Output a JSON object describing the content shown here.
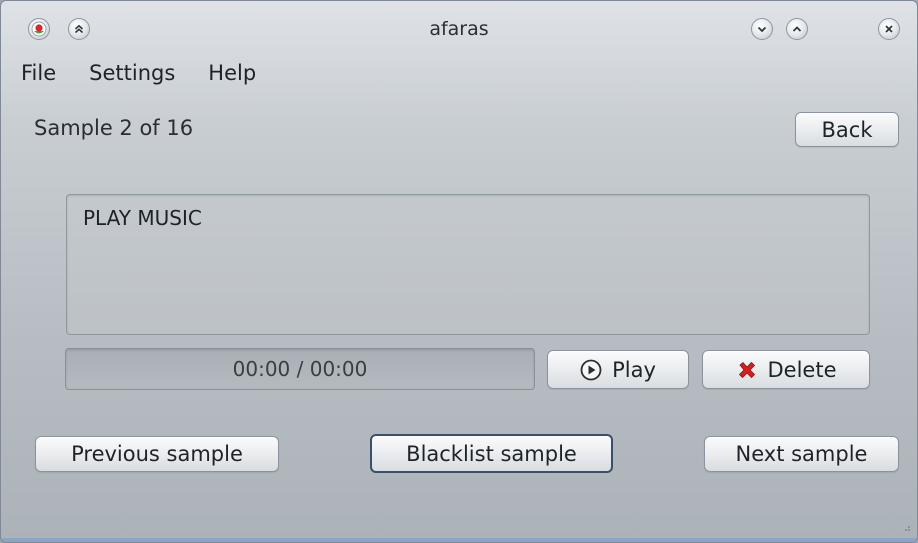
{
  "window": {
    "title": "afaras"
  },
  "menu": {
    "items": [
      "File",
      "Settings",
      "Help"
    ]
  },
  "header": {
    "sample_label": "Sample 2 of 16",
    "back_label": "Back"
  },
  "sample": {
    "text": "PLAY MUSIC"
  },
  "player": {
    "time_display": "00:00 / 00:00",
    "play_label": "Play",
    "delete_label": "Delete"
  },
  "navigation": {
    "previous_label": "Previous sample",
    "blacklist_label": "Blacklist sample",
    "next_label": "Next sample"
  },
  "icons": {
    "app": "app-icon",
    "shade": "double-chevron-up-icon",
    "minimize": "chevron-down-icon",
    "maximize": "chevron-up-icon",
    "close": "close-icon",
    "play": "play-icon",
    "delete": "red-x-icon"
  },
  "colors": {
    "delete_accent": "#d42020",
    "app_icon_red": "#d62a2a",
    "app_icon_green": "#3aa84a"
  }
}
